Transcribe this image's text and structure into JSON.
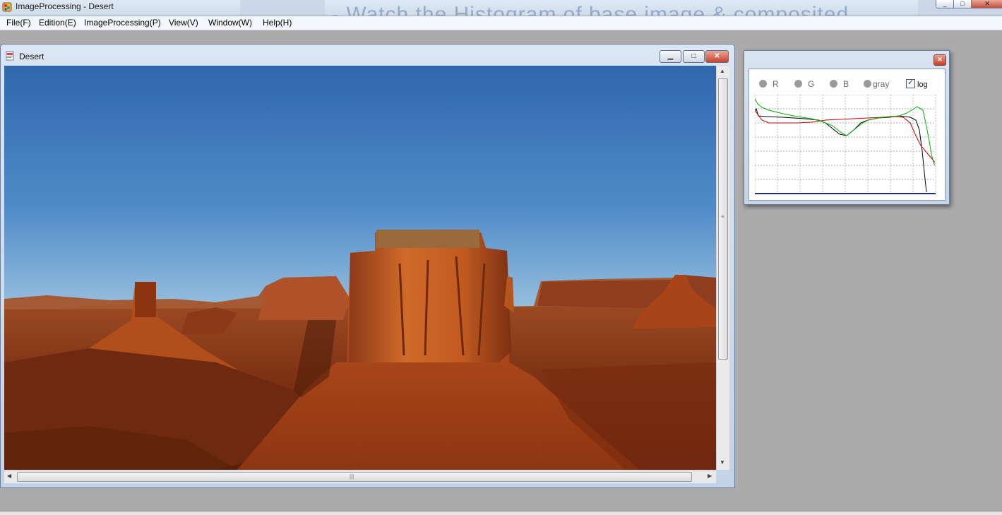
{
  "app": {
    "title": "ImageProcessing - Desert",
    "background_text": "- Watch the Histogram of base image & composited",
    "window_controls": [
      "_",
      "□",
      "✕"
    ]
  },
  "menu": [
    {
      "label": "File(F)"
    },
    {
      "label": "Edition(E)"
    },
    {
      "label": "ImageProcessing(P)"
    },
    {
      "label": "View(V)"
    },
    {
      "label": "Window(W)"
    },
    {
      "label": "Help(H)"
    }
  ],
  "child_window": {
    "title": "Desert",
    "controls": {
      "minimize": "▁",
      "maximize": "□",
      "close": "✕"
    },
    "image_alt": "Desert landscape with red rock buttes under a blue sky"
  },
  "histogram": {
    "close": "✕",
    "channels": [
      {
        "label": "R",
        "selected": false
      },
      {
        "label": "G",
        "selected": false
      },
      {
        "label": "B",
        "selected": false
      },
      {
        "label": "gray",
        "selected": false
      }
    ],
    "log_label": "log",
    "log_checked": true,
    "colors": {
      "red": "#cc0000",
      "green": "#00b000",
      "black": "#000000",
      "baseline": "#1b2a8c",
      "grid": "#9a9a9a"
    }
  }
}
